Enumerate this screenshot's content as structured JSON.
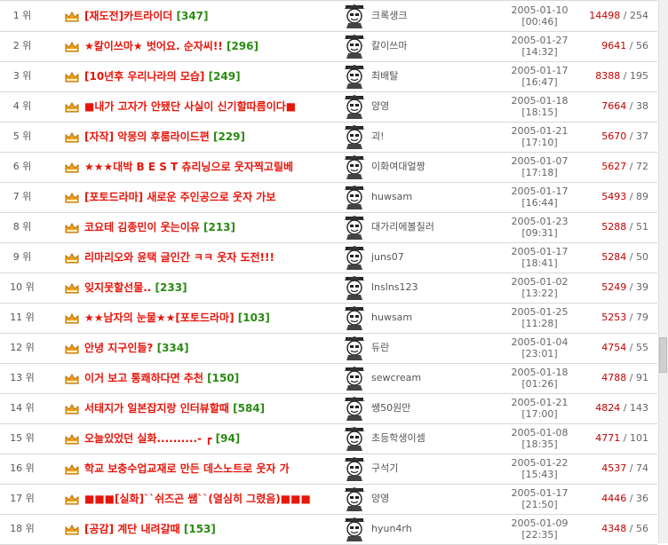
{
  "rows": [
    {
      "rank": "1 위",
      "title": "[재도전]카트라이더",
      "comments": "[347]",
      "author": "크록생크",
      "date": "2005-01-10",
      "time": "[00:46]",
      "views": "14498",
      "sep": " / ",
      "score": "254"
    },
    {
      "rank": "2 위",
      "title": "★칼이쓰마★ 벗어요. 순자씨!!",
      "comments": "[296]",
      "author": "칼이쓰마",
      "date": "2005-01-27",
      "time": "[14:32]",
      "views": "9641",
      "sep": " / ",
      "score": "56"
    },
    {
      "rank": "3 위",
      "title": "[10년후 우리나라의 모습]",
      "comments": "[249]",
      "author": "최배탈",
      "date": "2005-01-17",
      "time": "[16:47]",
      "views": "8388",
      "sep": " / ",
      "score": "195"
    },
    {
      "rank": "4 위",
      "title": "■내가 고자가 안됐단 사실이 신기할따름이다■",
      "comments": "",
      "author": "양영",
      "date": "2005-01-18",
      "time": "[18:15]",
      "views": "7664",
      "sep": " / ",
      "score": "38"
    },
    {
      "rank": "5 위",
      "title": "[자작] 악몽의 후룸라이드편",
      "comments": "[229]",
      "author": "괴!",
      "date": "2005-01-21",
      "time": "[17:10]",
      "views": "5670",
      "sep": " / ",
      "score": "37"
    },
    {
      "rank": "6 위",
      "title": "★★★대박 B E S T 츄리닝으로 웃자찍고릴베",
      "comments": "",
      "author": "이화여대얼짱",
      "date": "2005-01-07",
      "time": "[17:18]",
      "views": "5627",
      "sep": " / ",
      "score": "72"
    },
    {
      "rank": "7 위",
      "title": "[포토드라마] 새로운 주인공으로 웃자 가보",
      "comments": "",
      "author": "huwsam",
      "date": "2005-01-17",
      "time": "[16:44]",
      "views": "5493",
      "sep": " / ",
      "score": "89"
    },
    {
      "rank": "8 위",
      "title": "코요테 김종민이 웃는이유",
      "comments": "[213]",
      "author": "대가리에볼질러",
      "date": "2005-01-23",
      "time": "[09:31]",
      "views": "5288",
      "sep": " / ",
      "score": "51"
    },
    {
      "rank": "9 위",
      "title": "리마리오와 윤택 글인간 ㅋㅋ 웃자 도전!!!",
      "comments": "",
      "author": "juns07",
      "date": "2005-01-17",
      "time": "[18:41]",
      "views": "5284",
      "sep": " / ",
      "score": "50"
    },
    {
      "rank": "10 위",
      "title": "잊지못할선물..",
      "comments": "[233]",
      "author": "lnslns123",
      "date": "2005-01-02",
      "time": "[13:22]",
      "views": "5249",
      "sep": " / ",
      "score": "39"
    },
    {
      "rank": "11 위",
      "title": "★★남자의 눈물★★[포토드라마]",
      "comments": "[103]",
      "author": "huwsam",
      "date": "2005-01-25",
      "time": "[11:28]",
      "views": "5253",
      "sep": " / ",
      "score": "79"
    },
    {
      "rank": "12 위",
      "title": "안녕 지구인들?",
      "comments": "[334]",
      "author": "듀란",
      "date": "2005-01-04",
      "time": "[23:01]",
      "views": "4754",
      "sep": " / ",
      "score": "55"
    },
    {
      "rank": "13 위",
      "title": "이거 보고 통쾌하다면 추천",
      "comments": "[150]",
      "author": "sewcream",
      "date": "2005-01-18",
      "time": "[01:26]",
      "views": "4788",
      "sep": " / ",
      "score": "91"
    },
    {
      "rank": "14 위",
      "title": "서태지가 일본잡지랑 인터뷰할때",
      "comments": "[584]",
      "author": "쌩50원만",
      "date": "2005-01-21",
      "time": "[17:00]",
      "views": "4824",
      "sep": " / ",
      "score": "143"
    },
    {
      "rank": "15 위",
      "title": "오늘있었던 실화..........- ┏",
      "comments": "[94]",
      "author": "초등학생이셈",
      "date": "2005-01-08",
      "time": "[18:35]",
      "views": "4771",
      "sep": " / ",
      "score": "101"
    },
    {
      "rank": "16 위",
      "title": "학교 보충수업교재로 만든 데스노트로 웃자 가",
      "comments": "",
      "author": "구석기",
      "date": "2005-01-22",
      "time": "[15:43]",
      "views": "4537",
      "sep": " / ",
      "score": "74"
    },
    {
      "rank": "17 위",
      "title": "■■■[실화]``쉬즈곤 쌤``(열심히 그렸음)■■■",
      "comments": "",
      "author": "양영",
      "date": "2005-01-17",
      "time": "[21:50]",
      "views": "4446",
      "sep": " / ",
      "score": "36"
    },
    {
      "rank": "18 위",
      "title": "[공감] 계단 내려갈때",
      "comments": "[153]",
      "author": "hyun4rh",
      "date": "2005-01-09",
      "time": "[22:35]",
      "views": "4348",
      "sep": " / ",
      "score": "56"
    }
  ],
  "colors": {
    "title": "#e8150a",
    "comments": "#2a8a12",
    "views": "#c00000"
  },
  "icons": {
    "crown": "crown-icon",
    "avatar": "avatar-icon"
  }
}
